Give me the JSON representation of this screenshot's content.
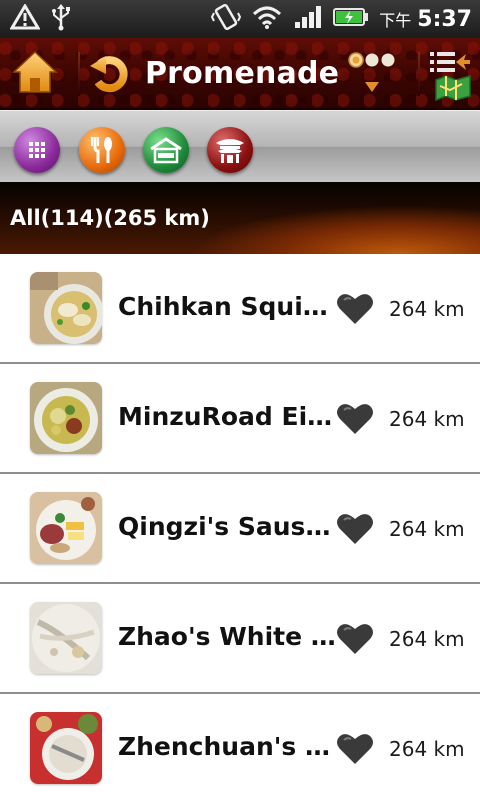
{
  "status_bar": {
    "ampm": "下午",
    "time": "5:37",
    "icons": [
      "alert-icon",
      "usb-icon",
      "vibrate-icon",
      "wifi-icon",
      "signal-icon",
      "battery-icon"
    ]
  },
  "title_bar": {
    "title": "Promenade",
    "icons": [
      "home-icon",
      "back-icon",
      "more-icon",
      "list-map-icon"
    ]
  },
  "category_bar": {
    "items": [
      {
        "icon": "grid-all-icon",
        "color": "#8a2a9a"
      },
      {
        "icon": "food-icon",
        "color": "#e86a0a"
      },
      {
        "icon": "hotel-icon",
        "color": "#1e8a3a"
      },
      {
        "icon": "temple-icon",
        "color": "#8a1010"
      }
    ]
  },
  "summary": {
    "text": "All(114)(265 km)"
  },
  "list": {
    "items": [
      {
        "name": "Chihkan Squid ...",
        "distance": "264 km",
        "favorite_icon": "heart-icon"
      },
      {
        "name": "MinzuRoad Eig...",
        "distance": "264 km",
        "favorite_icon": "heart-icon"
      },
      {
        "name": "Qingzi's Sausa...",
        "distance": "264 km",
        "favorite_icon": "heart-icon"
      },
      {
        "name": "Zhao's White S...",
        "distance": "264 km",
        "favorite_icon": "heart-icon"
      },
      {
        "name": "Zhenchuan's F...",
        "distance": "264 km",
        "favorite_icon": "heart-icon"
      }
    ]
  }
}
